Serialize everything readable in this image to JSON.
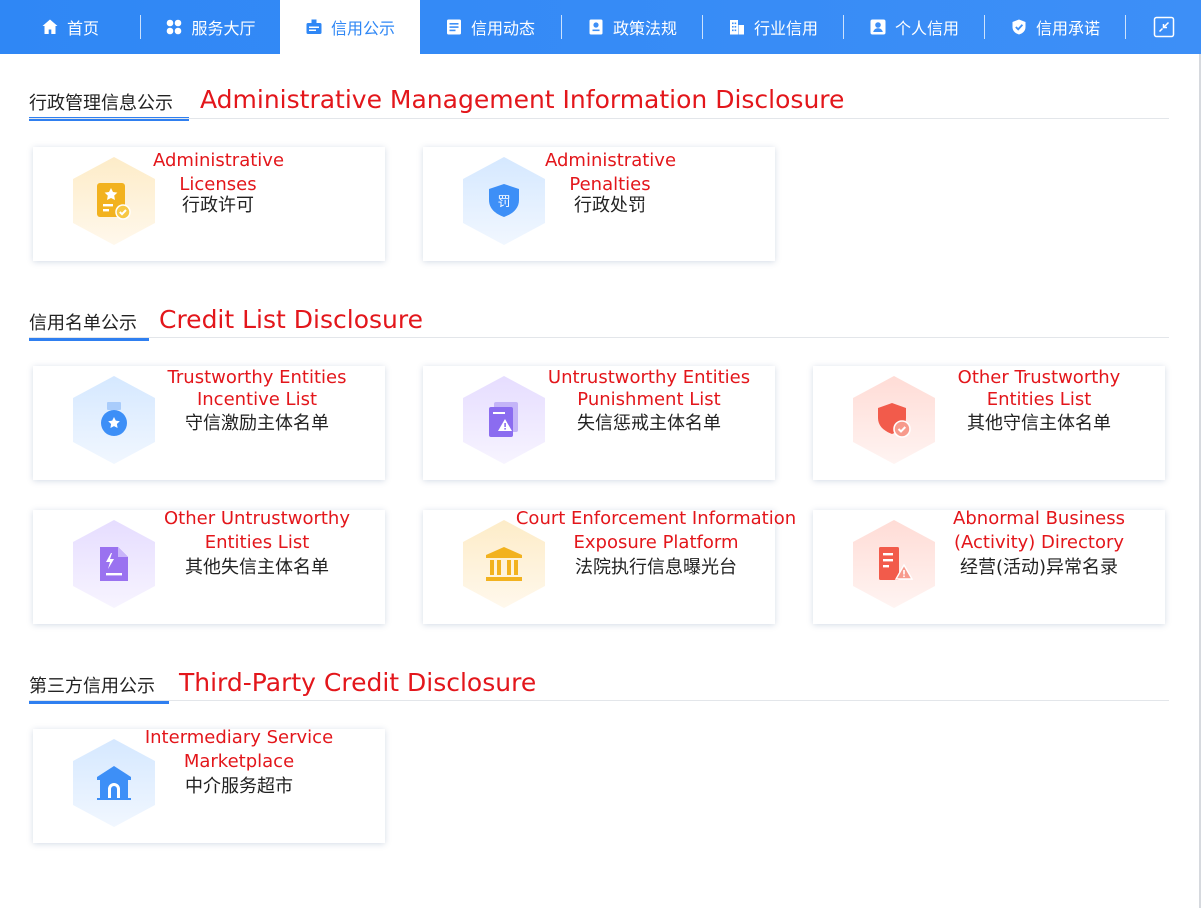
{
  "nav": {
    "items": [
      {
        "label": "首页",
        "icon": "home-icon"
      },
      {
        "label": "服务大厅",
        "icon": "apps-icon"
      },
      {
        "label": "信用公示",
        "icon": "announcement-icon",
        "active": true
      },
      {
        "label": "信用动态",
        "icon": "news-icon"
      },
      {
        "label": "政策法规",
        "icon": "law-book-icon"
      },
      {
        "label": "行业信用",
        "icon": "building-icon"
      },
      {
        "label": "个人信用",
        "icon": "person-card-icon"
      },
      {
        "label": "信用承诺",
        "icon": "shield-check-icon"
      }
    ],
    "collapse_icon": "collapse-icon"
  },
  "sections": [
    {
      "zh": "行政管理信息公示",
      "en": "Administrative Management Information Disclosure",
      "cards": [
        {
          "en1": "Administrative",
          "en2": "Licenses",
          "zh": "行政许可",
          "icon": "license-certificate-icon",
          "color": "#f2b21f"
        },
        {
          "en1": "Administrative",
          "en2": "Penalties",
          "zh": "行政处罚",
          "icon": "penalty-shield-icon",
          "color": "#3d8ff7"
        }
      ]
    },
    {
      "zh": "信用名单公示",
      "en": "Credit List Disclosure",
      "cards": [
        {
          "en1": "Trustworthy Entities",
          "en2": "Incentive List",
          "zh": "守信激励主体名单",
          "icon": "medal-icon",
          "color": "#3d8ff7"
        },
        {
          "en1": "Untrustworthy Entities",
          "en2": "Punishment List",
          "zh": "失信惩戒主体名单",
          "icon": "warning-document-icon",
          "color": "#8b6cf0"
        },
        {
          "en1": "Other Trustworthy",
          "en2": "Entities List",
          "zh": "其他守信主体名单",
          "icon": "shield-check-icon",
          "color": "#f25b4b"
        },
        {
          "en1": "Other Untrustworthy",
          "en2": "Entities List",
          "zh": "其他失信主体名单",
          "icon": "flash-document-icon",
          "color": "#9a72f0"
        },
        {
          "en1": "Court Enforcement Information",
          "en2": "Exposure Platform",
          "zh": "法院执行信息曝光台",
          "icon": "court-building-icon",
          "color": "#f2b21f"
        },
        {
          "en1": "Abnormal Business",
          "en2": "(Activity) Directory",
          "zh": "经营(活动)异常名录",
          "icon": "abnormal-building-icon",
          "color": "#f25b4b"
        }
      ]
    },
    {
      "zh": "第三方信用公示",
      "en": "Third-Party Credit Disclosure",
      "cards": [
        {
          "en1": "Intermediary Service",
          "en2": "Marketplace",
          "zh": "中介服务超市",
          "icon": "marketplace-house-icon",
          "color": "#3d8ff7"
        }
      ]
    }
  ]
}
